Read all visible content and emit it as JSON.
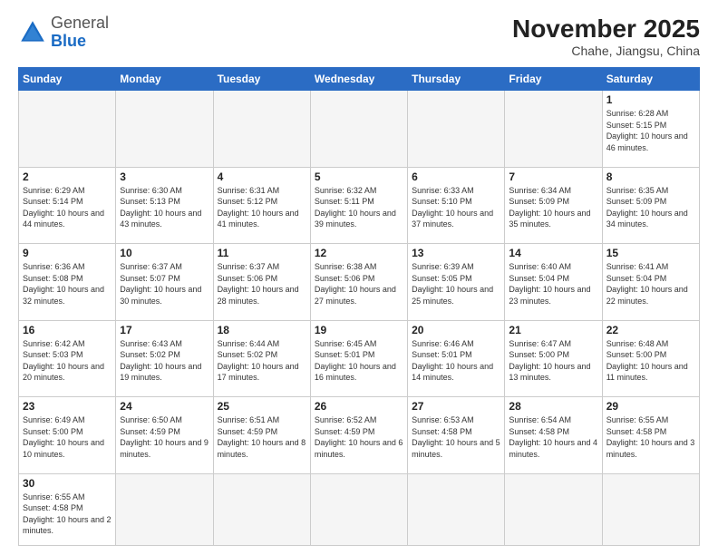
{
  "logo": {
    "general": "General",
    "blue": "Blue"
  },
  "header": {
    "month": "November 2025",
    "location": "Chahe, Jiangsu, China"
  },
  "days_of_week": [
    "Sunday",
    "Monday",
    "Tuesday",
    "Wednesday",
    "Thursday",
    "Friday",
    "Saturday"
  ],
  "weeks": [
    [
      {
        "day": "",
        "empty": true
      },
      {
        "day": "",
        "empty": true
      },
      {
        "day": "",
        "empty": true
      },
      {
        "day": "",
        "empty": true
      },
      {
        "day": "",
        "empty": true
      },
      {
        "day": "",
        "empty": true
      },
      {
        "day": "1",
        "info": "Sunrise: 6:28 AM\nSunset: 5:15 PM\nDaylight: 10 hours and 46 minutes."
      }
    ],
    [
      {
        "day": "2",
        "info": "Sunrise: 6:29 AM\nSunset: 5:14 PM\nDaylight: 10 hours and 44 minutes."
      },
      {
        "day": "3",
        "info": "Sunrise: 6:30 AM\nSunset: 5:13 PM\nDaylight: 10 hours and 43 minutes."
      },
      {
        "day": "4",
        "info": "Sunrise: 6:31 AM\nSunset: 5:12 PM\nDaylight: 10 hours and 41 minutes."
      },
      {
        "day": "5",
        "info": "Sunrise: 6:32 AM\nSunset: 5:11 PM\nDaylight: 10 hours and 39 minutes."
      },
      {
        "day": "6",
        "info": "Sunrise: 6:33 AM\nSunset: 5:10 PM\nDaylight: 10 hours and 37 minutes."
      },
      {
        "day": "7",
        "info": "Sunrise: 6:34 AM\nSunset: 5:09 PM\nDaylight: 10 hours and 35 minutes."
      },
      {
        "day": "8",
        "info": "Sunrise: 6:35 AM\nSunset: 5:09 PM\nDaylight: 10 hours and 34 minutes."
      }
    ],
    [
      {
        "day": "9",
        "info": "Sunrise: 6:36 AM\nSunset: 5:08 PM\nDaylight: 10 hours and 32 minutes."
      },
      {
        "day": "10",
        "info": "Sunrise: 6:37 AM\nSunset: 5:07 PM\nDaylight: 10 hours and 30 minutes."
      },
      {
        "day": "11",
        "info": "Sunrise: 6:37 AM\nSunset: 5:06 PM\nDaylight: 10 hours and 28 minutes."
      },
      {
        "day": "12",
        "info": "Sunrise: 6:38 AM\nSunset: 5:06 PM\nDaylight: 10 hours and 27 minutes."
      },
      {
        "day": "13",
        "info": "Sunrise: 6:39 AM\nSunset: 5:05 PM\nDaylight: 10 hours and 25 minutes."
      },
      {
        "day": "14",
        "info": "Sunrise: 6:40 AM\nSunset: 5:04 PM\nDaylight: 10 hours and 23 minutes."
      },
      {
        "day": "15",
        "info": "Sunrise: 6:41 AM\nSunset: 5:04 PM\nDaylight: 10 hours and 22 minutes."
      }
    ],
    [
      {
        "day": "16",
        "info": "Sunrise: 6:42 AM\nSunset: 5:03 PM\nDaylight: 10 hours and 20 minutes."
      },
      {
        "day": "17",
        "info": "Sunrise: 6:43 AM\nSunset: 5:02 PM\nDaylight: 10 hours and 19 minutes."
      },
      {
        "day": "18",
        "info": "Sunrise: 6:44 AM\nSunset: 5:02 PM\nDaylight: 10 hours and 17 minutes."
      },
      {
        "day": "19",
        "info": "Sunrise: 6:45 AM\nSunset: 5:01 PM\nDaylight: 10 hours and 16 minutes."
      },
      {
        "day": "20",
        "info": "Sunrise: 6:46 AM\nSunset: 5:01 PM\nDaylight: 10 hours and 14 minutes."
      },
      {
        "day": "21",
        "info": "Sunrise: 6:47 AM\nSunset: 5:00 PM\nDaylight: 10 hours and 13 minutes."
      },
      {
        "day": "22",
        "info": "Sunrise: 6:48 AM\nSunset: 5:00 PM\nDaylight: 10 hours and 11 minutes."
      }
    ],
    [
      {
        "day": "23",
        "info": "Sunrise: 6:49 AM\nSunset: 5:00 PM\nDaylight: 10 hours and 10 minutes."
      },
      {
        "day": "24",
        "info": "Sunrise: 6:50 AM\nSunset: 4:59 PM\nDaylight: 10 hours and 9 minutes."
      },
      {
        "day": "25",
        "info": "Sunrise: 6:51 AM\nSunset: 4:59 PM\nDaylight: 10 hours and 8 minutes."
      },
      {
        "day": "26",
        "info": "Sunrise: 6:52 AM\nSunset: 4:59 PM\nDaylight: 10 hours and 6 minutes."
      },
      {
        "day": "27",
        "info": "Sunrise: 6:53 AM\nSunset: 4:58 PM\nDaylight: 10 hours and 5 minutes."
      },
      {
        "day": "28",
        "info": "Sunrise: 6:54 AM\nSunset: 4:58 PM\nDaylight: 10 hours and 4 minutes."
      },
      {
        "day": "29",
        "info": "Sunrise: 6:55 AM\nSunset: 4:58 PM\nDaylight: 10 hours and 3 minutes."
      }
    ],
    [
      {
        "day": "30",
        "info": "Sunrise: 6:55 AM\nSunset: 4:58 PM\nDaylight: 10 hours and 2 minutes."
      },
      {
        "day": "",
        "empty": true
      },
      {
        "day": "",
        "empty": true
      },
      {
        "day": "",
        "empty": true
      },
      {
        "day": "",
        "empty": true
      },
      {
        "day": "",
        "empty": true
      },
      {
        "day": "",
        "empty": true
      }
    ]
  ]
}
